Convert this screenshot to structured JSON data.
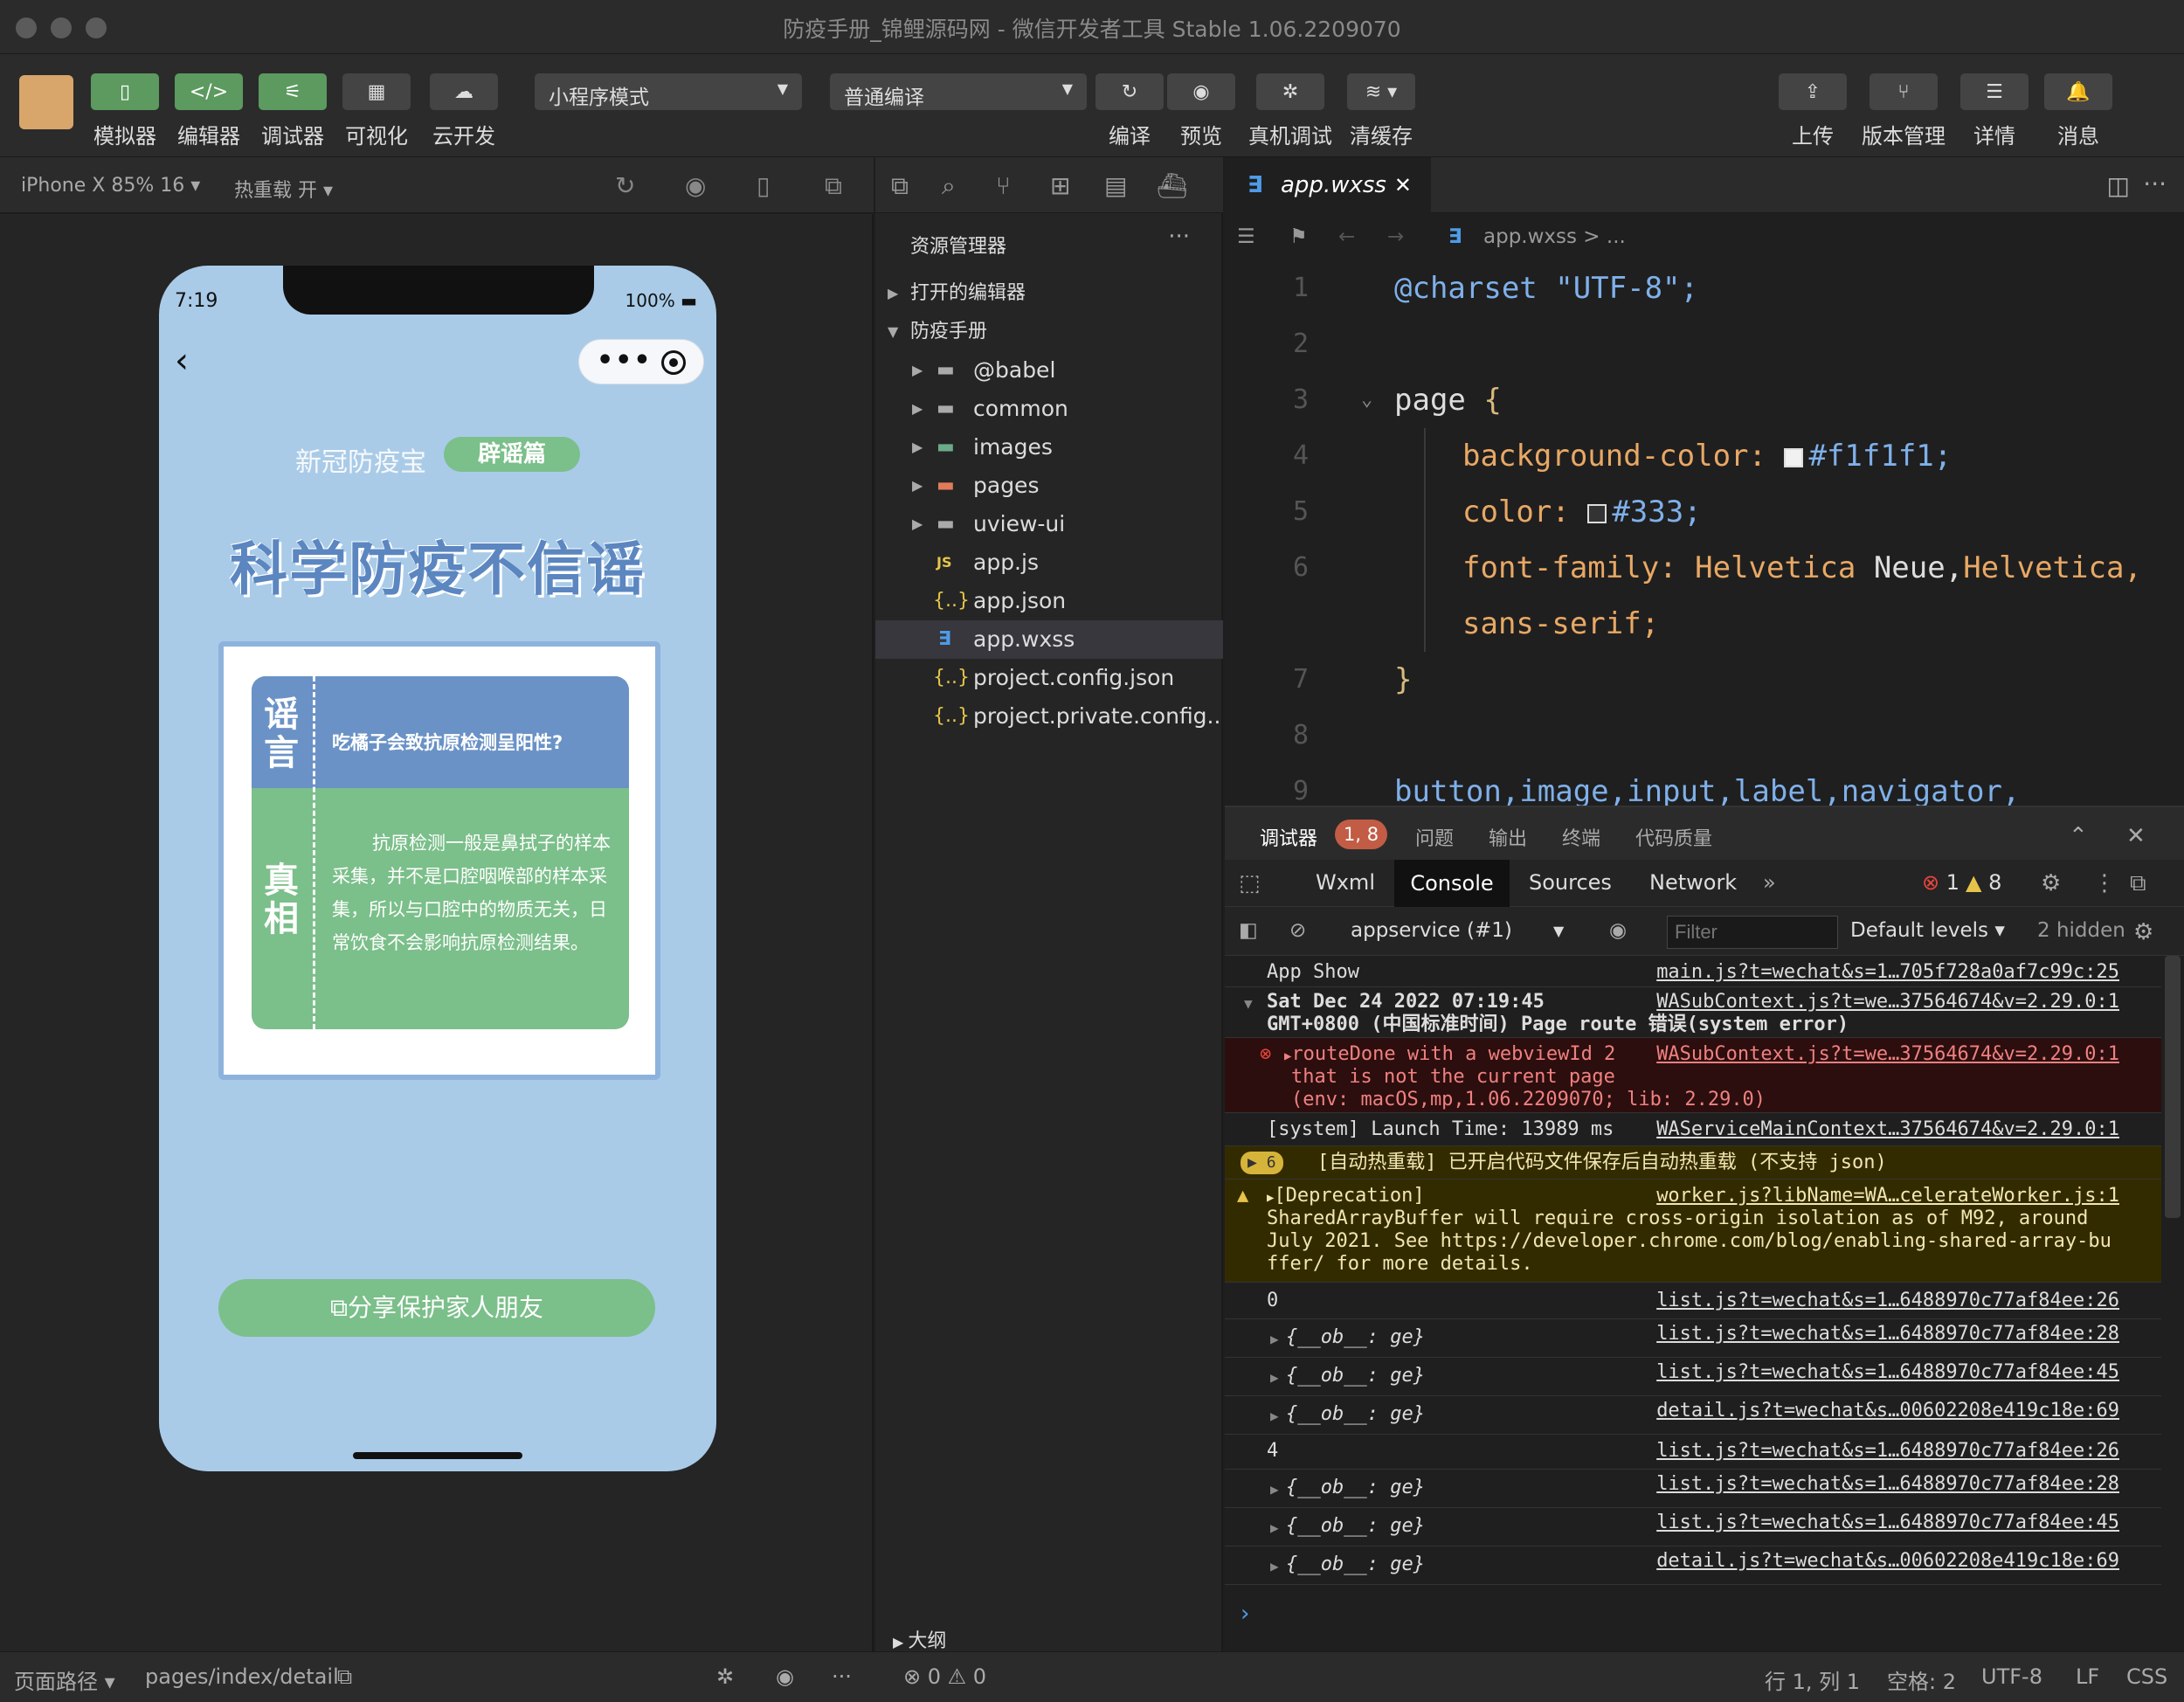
{
  "window": {
    "title": "防疫手册_锦鲤源码网 - 微信开发者工具 Stable 1.06.2209070"
  },
  "toolbar": {
    "left": [
      {
        "label": "模拟器",
        "icon": "phone-icon"
      },
      {
        "label": "编辑器",
        "icon": "code-icon"
      },
      {
        "label": "调试器",
        "icon": "debug-panel-icon"
      },
      {
        "label": "可视化",
        "icon": "layout-icon"
      },
      {
        "label": "云开发",
        "icon": "cloud-icon"
      }
    ],
    "mode_select": "小程序模式",
    "compile_select": "普通编译",
    "middle": [
      {
        "label": "编译",
        "icon": "refresh-icon"
      },
      {
        "label": "预览",
        "icon": "eye-icon"
      },
      {
        "label": "真机调试",
        "icon": "bug-icon"
      },
      {
        "label": "清缓存",
        "icon": "layers-icon"
      }
    ],
    "right": [
      {
        "label": "上传",
        "icon": "upload-icon"
      },
      {
        "label": "版本管理",
        "icon": "branch-icon"
      },
      {
        "label": "详情",
        "icon": "menu-icon"
      },
      {
        "label": "消息",
        "icon": "bell-icon"
      }
    ]
  },
  "simulator": {
    "device": "iPhone X 85% 16 ▾",
    "hot_reload": "热重载 开 ▾",
    "status_time": "7:19",
    "battery": "100%",
    "subtitle": "新冠防疫宝",
    "badge": "辟谣篇",
    "title": "科学防疫不信谣",
    "rumor_tag": "谣言",
    "truth_tag": "真相",
    "question": "吃橘子会致抗原检测呈阳性?",
    "answer": "抗原检测一般是鼻拭子的样本采集，并不是口腔咽喉部的样本采集，所以与口腔中的物质无关，日常饮食不会影响抗原检测结果。",
    "share_button": "分享保护家人朋友"
  },
  "explorer": {
    "title": "资源管理器",
    "open_editors": "打开的编辑器",
    "project": "防疫手册",
    "items": [
      {
        "name": "@babel",
        "type": "folder"
      },
      {
        "name": "common",
        "type": "folder"
      },
      {
        "name": "images",
        "type": "folder"
      },
      {
        "name": "pages",
        "type": "folder"
      },
      {
        "name": "uview-ui",
        "type": "folder"
      },
      {
        "name": "app.js",
        "type": "js"
      },
      {
        "name": "app.json",
        "type": "json"
      },
      {
        "name": "app.wxss",
        "type": "css"
      },
      {
        "name": "project.config.json",
        "type": "json"
      },
      {
        "name": "project.private.config...",
        "type": "json"
      }
    ],
    "outline": "大纲"
  },
  "editor": {
    "tab": "app.wxss",
    "breadcrumb": "app.wxss > ...",
    "lines": {
      "l1": "@charset \"UTF-8\";",
      "l3a": "page",
      "l3b": "{",
      "l4prop": "background-color:",
      "l4val": "#f1f1f1;",
      "l5prop": "color:",
      "l5val": "#333;",
      "l6prop": "font-family:",
      "l6v1": "Helvetica",
      "l6v2": " Neue,",
      "l6v3": "Helvetica,",
      "l6cont": "sans-serif;",
      "l7": "}",
      "l9": "button,image,input,label,navigator,"
    }
  },
  "debugger": {
    "tabs": [
      "调试器",
      "问题",
      "输出",
      "终端",
      "代码质量"
    ],
    "badge": "1, 8",
    "subtabs": [
      "Wxml",
      "Console",
      "Sources",
      "Network",
      "»"
    ],
    "errors": "1",
    "warnings": "8",
    "context": "appservice (#1)",
    "filter_placeholder": "Filter",
    "levels": "Default levels ▾",
    "hidden": "2 hidden",
    "logs": {
      "r1": {
        "msg": "App Show",
        "src": "main.js?t=wechat&s=1…705f728a0af7c99c:25"
      },
      "r2": {
        "msg": "Sat Dec 24 2022 07:19:45",
        "msg2": "GMT+0800 (中国标准时间) Page route 错误(system error)",
        "src": "WASubContext.js?t=we…37564674&v=2.29.0:1"
      },
      "r3": {
        "msg": "routeDone with a webviewId 2",
        "msg2": "that is not the current page",
        "msg3": "(env: macOS,mp,1.06.2209070; lib: 2.29.0)",
        "src": "WASubContext.js?t=we…37564674&v=2.29.0:1"
      },
      "r4": {
        "msg": "[system] Launch Time: 13989 ms",
        "src": "WAServiceMainContext…37564674&v=2.29.0:1"
      },
      "r5": {
        "count": "6",
        "msg": "[自动热重载] 已开启代码文件保存后自动热重载 (不支持 json)"
      },
      "r6": {
        "msg": "[Deprecation]",
        "msg2": "SharedArrayBuffer will require cross-origin isolation as of M92, around",
        "msg3": "July 2021. See https://developer.chrome.com/blog/enabling-shared-array-bu",
        "msg4": "ffer/ for more details.",
        "src": "worker.js?libName=WA…celerateWorker.js:1"
      },
      "r7": {
        "msg": "0",
        "src": "list.js?t=wechat&s=1…6488970c77af84ee:26"
      },
      "r8": {
        "msg": "{__ob__: ge}",
        "src": "list.js?t=wechat&s=1…6488970c77af84ee:28"
      },
      "r9": {
        "msg": "{__ob__: ge}",
        "src": "list.js?t=wechat&s=1…6488970c77af84ee:45"
      },
      "r10": {
        "msg": "{__ob__: ge}",
        "src": "detail.js?t=wechat&s…00602208e419c18e:69"
      },
      "r11": {
        "msg": "4",
        "src": "list.js?t=wechat&s=1…6488970c77af84ee:26"
      },
      "r12": {
        "msg": "{__ob__: ge}",
        "src": "list.js?t=wechat&s=1…6488970c77af84ee:28"
      },
      "r13": {
        "msg": "{__ob__: ge}",
        "src": "list.js?t=wechat&s=1…6488970c77af84ee:45"
      },
      "r14": {
        "msg": "{__ob__: ge}",
        "src": "detail.js?t=wechat&s…00602208e419c18e:69"
      }
    }
  },
  "statusbar": {
    "page_path_label": "页面路径 ▾",
    "page_path": "pages/index/detail",
    "errors": "⊗ 0 ⚠ 0",
    "position": "行 1, 列 1",
    "spaces": "空格: 2",
    "encoding": "UTF-8",
    "eol": "LF",
    "lang": "CSS"
  },
  "colors": {
    "accent_green": "#5c9a5f",
    "phone_bg": "#a9cbe8",
    "card_blue": "#6a92c6",
    "card_green": "#7bbf8a"
  }
}
